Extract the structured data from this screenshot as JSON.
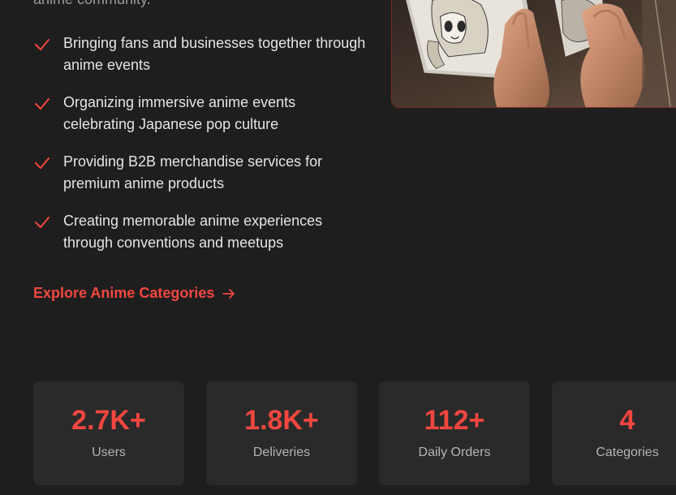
{
  "intro": {
    "text_tail": "anime community."
  },
  "features": [
    {
      "text": "Bringing fans and businesses together through anime events",
      "icon": "check-icon"
    },
    {
      "text": "Organizing immersive anime events celebrating Japanese pop culture",
      "icon": "check-icon"
    },
    {
      "text": "Providing B2B merchandise services for premium anime products",
      "icon": "check-icon"
    },
    {
      "text": "Creating memorable anime experiences through conventions and meetups",
      "icon": "check-icon"
    }
  ],
  "cta": {
    "label": "Explore Anime Categories",
    "icon": "arrow-right-icon"
  },
  "stats": [
    {
      "value": "2.7K+",
      "label": "Users"
    },
    {
      "value": "1.8K+",
      "label": "Deliveries"
    },
    {
      "value": "112+",
      "label": "Daily Orders"
    },
    {
      "value": "4",
      "label": "Categories"
    }
  ],
  "colors": {
    "background": "#1e1e1e",
    "accent": "#f2473f",
    "card": "#2a2a2a",
    "text": "#e4e4e4",
    "muted": "#b4b4b4"
  }
}
